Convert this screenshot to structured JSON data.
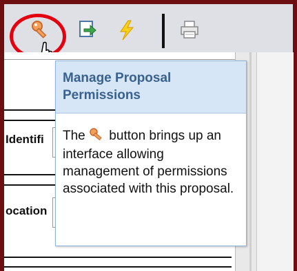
{
  "toolbar": {
    "buttons": [
      {
        "icon": "key-icon"
      },
      {
        "icon": "export-arrow-icon"
      },
      {
        "icon": "lightning-icon"
      },
      {
        "icon": "printer-icon"
      }
    ]
  },
  "form": {
    "identifier_label": "Identifi",
    "location_label": "ocation"
  },
  "tooltip": {
    "title": "Manage Proposal Permissions",
    "body_before_icon": "The ",
    "body_after_icon": " button brings up an interface allowing management of permissions associated with this proposal."
  },
  "colors": {
    "frame": "#6d0f10",
    "highlight": "#e3000f",
    "tooltip_header": "#d6e6f7",
    "tooltip_title": "#39618f"
  }
}
